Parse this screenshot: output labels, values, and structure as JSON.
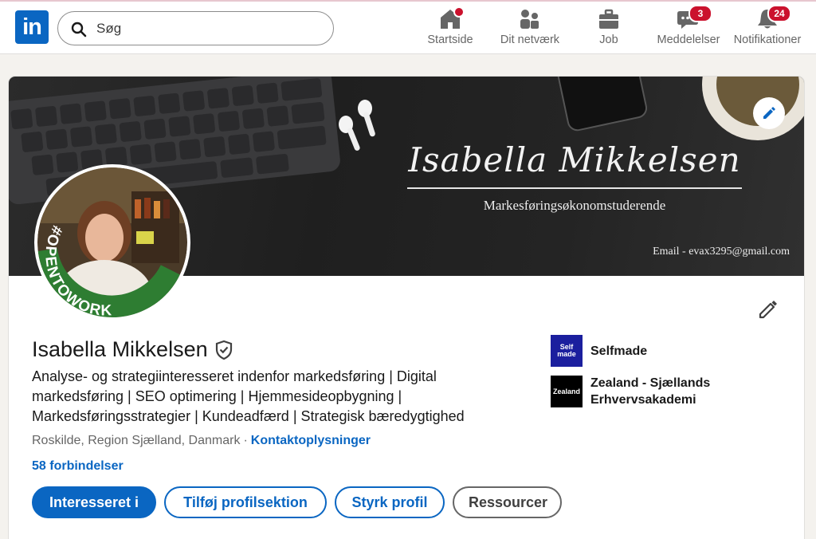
{
  "nav": {
    "logo_text": "in",
    "search_placeholder": "Søg",
    "items": [
      {
        "label": "Startside",
        "badge": ""
      },
      {
        "label": "Dit netværk",
        "badge": ""
      },
      {
        "label": "Job",
        "badge": ""
      },
      {
        "label": "Meddelelser",
        "badge": "3"
      },
      {
        "label": "Notifikationer",
        "badge": "24"
      }
    ]
  },
  "banner": {
    "name": "Isabella Mikkelsen",
    "subtitle": "Markesføringsøkonomstuderende",
    "email": "Email - evax3295@gmail.com"
  },
  "avatar": {
    "frame_text": "#OPENTOWORK"
  },
  "profile": {
    "name": "Isabella Mikkelsen",
    "headline": "Analyse- og strategiinteresseret indenfor markedsføring | Digital markedsføring | SEO optimering | Hjemmesideopbygning | Markedsføringsstrategier | Kundeadfærd | Strategisk bæredygtighed",
    "location": "Roskilde, Region Sjælland, Danmark",
    "separator": "·",
    "contact_link": "Kontaktoplysninger",
    "connections": "58 forbindelser"
  },
  "actions": {
    "interested": "Interesseret i",
    "add_section": "Tilføj profilsektion",
    "boost": "Styrk profil",
    "resources": "Ressourcer"
  },
  "organizations": [
    {
      "name": "Selfmade",
      "logo_text": "Self made",
      "logo_color": "#1b1f9e"
    },
    {
      "name": "Zealand - Sjællands Erhvervsakademi",
      "logo_text": "Zealand",
      "logo_color": "#000000"
    }
  ],
  "colors": {
    "brand": "#0a66c2",
    "badge": "#cb112d",
    "open_to_work": "#2e7d32"
  }
}
